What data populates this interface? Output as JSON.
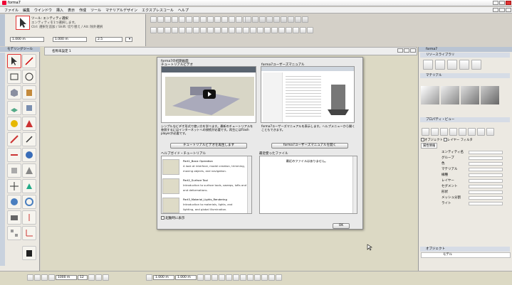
{
  "window": {
    "title": "forma7"
  },
  "menu": {
    "items": [
      "ファイル",
      "編集",
      "ウインドウ",
      "挿入",
      "表示",
      "作成",
      "ツール",
      "マテリアルデザイン",
      "エクスプレスコール",
      "ヘルプ"
    ]
  },
  "select_panel": {
    "line1": "ツール: エンティティ選択",
    "line2": "エンティティを1つ選択します。",
    "line3": "Ctrl: 選択を追加 / Shift: 切り替え / Alt: 除外選択",
    "field_value": "1.000 m",
    "field2": "1.000 m",
    "field3": "2.5"
  },
  "tools_tray": {
    "title": "モデリングツール"
  },
  "inner_window": {
    "title": "名称未設定 1"
  },
  "welcome": {
    "tutorial_heading_line1": "forma7の初期画面",
    "tutorial_heading_line2": "チュートリアルビデオ",
    "tutorial_desc": "シンプルなビデオ形式で使い方を学べます。最新のチュートリアルを参照するにはインターネットへの接続が必要です。再生にはFlash playerが必要です。",
    "tutorial_button": "チュートリアルビデオを再生します",
    "manual_heading": "forma7ユーザーズマニュアル",
    "manual_desc": "forma7ユーザーズマニュアルを表示します。ヘルプメニューから開くこともできます。",
    "manual_button": "forma7ユーザーズマニュアルを開く",
    "tutorial_list_heading": "ヘルプガイド・チュートリアル",
    "tutorial_items": [
      {
        "title": "Part1_Basic Operation",
        "desc1": "A look at interface, model creation, trimming,",
        "desc2": "moving objects, and navigation."
      },
      {
        "title": "Part2_Surface Tool",
        "desc1": "Introduction to surface tools, sweeps, lofts and",
        "desc2": "and deformations."
      },
      {
        "title": "Part3_Material_Lights_Rendering",
        "desc1": "Introduction to materials, lights, and",
        "desc2": "lighting, and global illumination."
      }
    ],
    "recent_heading": "最近使ったファイル",
    "recent_empty": "最近のファイルはありません。",
    "show_at_startup": "起動時に表示",
    "ok": "OK"
  },
  "right_panel": {
    "title": "forma7",
    "sec_resources": "リソースライブラリ",
    "sec_material": "マテリアル",
    "sec_properties": "プロパティ・ビュー",
    "tabs": [
      "オブジェクト",
      "マテリアル",
      "フィルタ"
    ],
    "checkboxes": [
      "オブジェクト",
      "レイヤー",
      "フィルタ"
    ],
    "subtab": "属性情報",
    "properties": [
      {
        "label": "エンティティ名",
        "value": ""
      },
      {
        "label": "グループ",
        "value": ""
      },
      {
        "label": "色",
        "value": ""
      },
      {
        "label": "マテリアル",
        "value": ""
      },
      {
        "label": "線種",
        "value": ""
      },
      {
        "label": "レイヤー",
        "value": ""
      },
      {
        "label": "セグメント",
        "value": ""
      },
      {
        "label": "形状",
        "value": ""
      },
      {
        "label": "メッシュ分割",
        "value": ""
      },
      {
        "label": "ライト",
        "value": ""
      }
    ],
    "sec_object": "オブジェクト",
    "object_row": "モデル"
  },
  "status": {
    "unit_value": "1000 m",
    "snap_value": "1.000 m",
    "grid_value": "1.000 m",
    "zoom": "12"
  }
}
